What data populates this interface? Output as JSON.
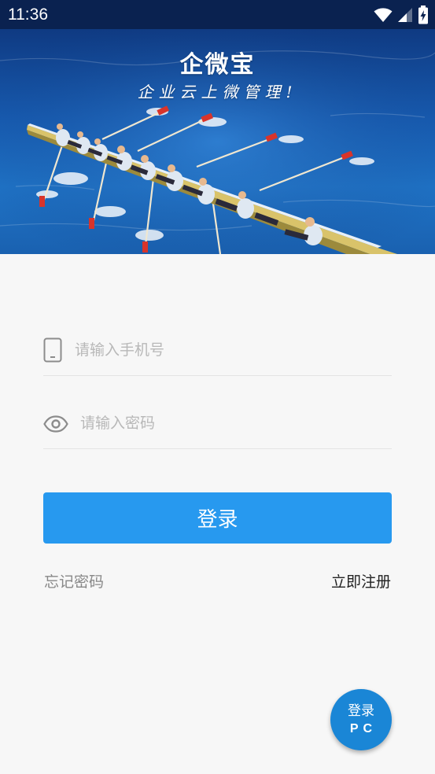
{
  "status_bar": {
    "time": "11:36",
    "icons": [
      "wifi-icon",
      "cellular-signal-icon",
      "battery-charging-icon"
    ]
  },
  "banner": {
    "brand_name": "企微宝",
    "slogan": "企业云上微管理!"
  },
  "login_form": {
    "phone_placeholder": "请输入手机号",
    "phone_value": "",
    "phone_icon": "phone-icon",
    "password_placeholder": "请输入密码",
    "password_value": "",
    "password_icon": "eye-icon",
    "login_label": "登录"
  },
  "links": {
    "forgot_password": "忘记密码",
    "register": "立即注册"
  },
  "fab": {
    "line1": "登录",
    "line2": "PC"
  },
  "colors": {
    "status_bar": "#0a2250",
    "primary_button": "#2799ef",
    "fab": "#1a86d6",
    "background": "#f7f7f7"
  }
}
